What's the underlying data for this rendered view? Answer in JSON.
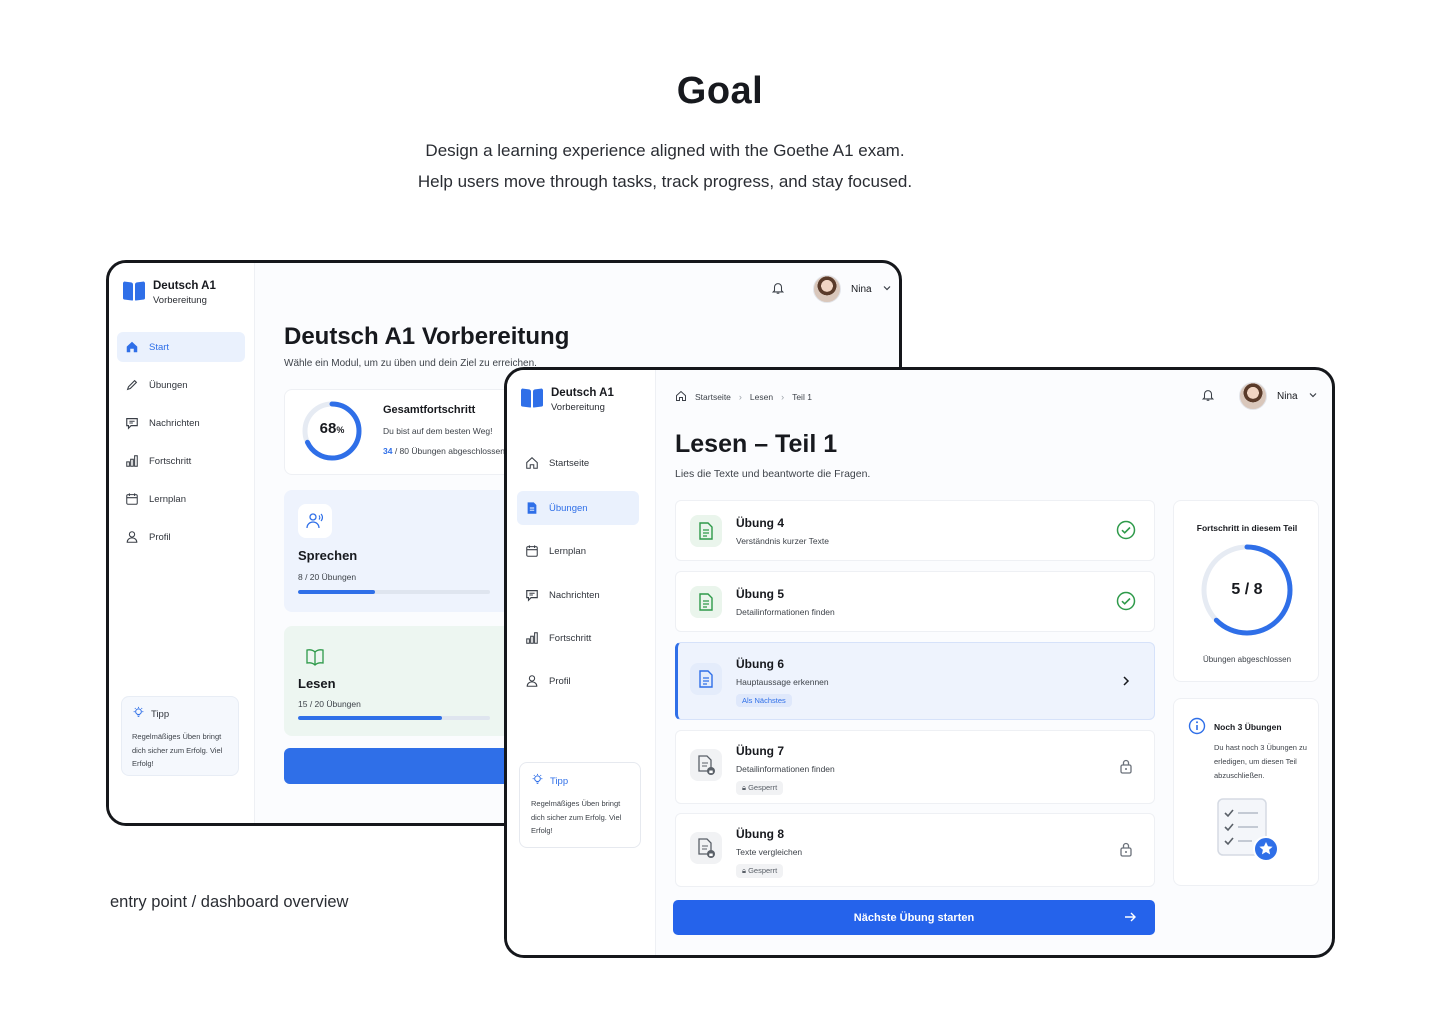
{
  "goal": {
    "title": "Goal",
    "line1": "Design a learning experience aligned with the Goethe A1 exam.",
    "line2": "Help users move through tasks, track progress, and stay focused."
  },
  "caption": "entry point / dashboard overview",
  "colors": {
    "accent": "#2f6fe8",
    "success": "#2e9a4a",
    "text": "#17191e"
  },
  "dashboard": {
    "brand": {
      "title": "Deutsch A1",
      "subtitle": "Vorbereitung"
    },
    "nav": [
      {
        "label": "Start",
        "icon": "home-icon",
        "active": true
      },
      {
        "label": "Übungen",
        "icon": "pencil-icon"
      },
      {
        "label": "Nachrichten",
        "icon": "message-icon"
      },
      {
        "label": "Fortschritt",
        "icon": "chart-icon"
      },
      {
        "label": "Lernplan",
        "icon": "calendar-icon"
      },
      {
        "label": "Profil",
        "icon": "user-icon"
      }
    ],
    "tip": {
      "title": "Tipp",
      "text": "Regelmäßiges Üben bringt dich sicher zum Erfolg. Viel Erfolg!"
    },
    "user": {
      "name": "Nina"
    },
    "title": "Deutsch A1 Vorbereitung",
    "subtitle": "Wähle ein Modul, um zu üben und dein Ziel zu erreichen.",
    "overall": {
      "percent": 68,
      "percent_label": "68",
      "percent_unit": "%",
      "title": "Gesamtfortschritt",
      "message": "Du bist auf dem besten Weg!",
      "done": "34",
      "total_label": " / 80 Übungen abgeschlossen"
    },
    "modules": [
      {
        "name": "Sprechen",
        "count": "8 / 20 Übungen",
        "progress": 0.4,
        "icon": "speaking-people-icon"
      },
      {
        "name": "Lesen",
        "count": "15 / 20 Übungen",
        "progress": 0.75,
        "icon": "open-book-icon"
      }
    ]
  },
  "exercise": {
    "brand": {
      "title": "Deutsch A1",
      "subtitle": "Vorbereitung"
    },
    "nav": [
      {
        "label": "Startseite",
        "icon": "home-icon"
      },
      {
        "label": "Übungen",
        "icon": "document-icon",
        "active": true
      },
      {
        "label": "Lernplan",
        "icon": "calendar-icon"
      },
      {
        "label": "Nachrichten",
        "icon": "message-icon"
      },
      {
        "label": "Fortschritt",
        "icon": "chart-icon"
      },
      {
        "label": "Profil",
        "icon": "user-icon"
      }
    ],
    "tip": {
      "title": "Tipp",
      "text": "Regelmäßiges Üben bringt dich sicher zum Erfolg. Viel Erfolg!"
    },
    "user": {
      "name": "Nina"
    },
    "breadcrumb": [
      "Startseite",
      "Lesen",
      "Teil 1"
    ],
    "title": "Lesen – Teil 1",
    "subtitle": "Lies die Texte und beantworte die Fragen.",
    "items": [
      {
        "name": "Übung 4",
        "desc": "Verständnis kurzer Texte",
        "status": "done"
      },
      {
        "name": "Übung 5",
        "desc": "Detailinformationen finden",
        "status": "done"
      },
      {
        "name": "Übung 6",
        "desc": "Hauptaussage erkennen",
        "status": "next",
        "badge": "Als Nächstes"
      },
      {
        "name": "Übung 7",
        "desc": "Detailinformationen finden",
        "status": "locked",
        "badge": "Gesperrt"
      },
      {
        "name": "Übung 8",
        "desc": "Texte vergleichen",
        "status": "locked",
        "badge": "Gesperrt"
      }
    ],
    "progress": {
      "title": "Fortschritt in diesem Teil",
      "done": 5,
      "total": 8,
      "label": "5 / 8",
      "footer": "Übungen abgeschlossen"
    },
    "info": {
      "title": "Noch 3 Übungen",
      "text": "Du hast noch 3 Übungen zu erledigen, um diesen Teil abzuschließen."
    },
    "cta": "Nächste Übung starten"
  }
}
